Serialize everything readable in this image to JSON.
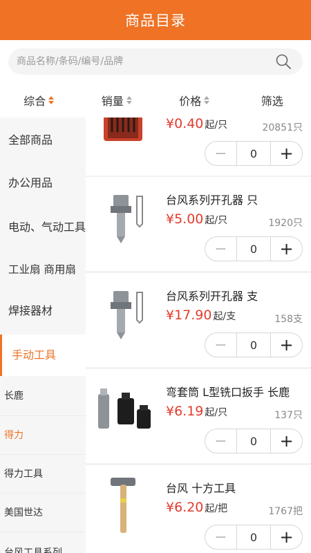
{
  "header": {
    "title": "商品目录"
  },
  "search": {
    "placeholder": "商品名称/条码/编号/品牌",
    "icon": "search-icon"
  },
  "sort": {
    "items": [
      {
        "label": "综合",
        "arrows": true,
        "active": true
      },
      {
        "label": "销量",
        "arrows": true,
        "active": false
      },
      {
        "label": "价格",
        "arrows": true,
        "active": false
      },
      {
        "label": "筛选",
        "arrows": false,
        "active": false
      }
    ]
  },
  "sidebar": {
    "categories": [
      "全部商品",
      "办公用品",
      "电动、气动工具",
      "工业扇 商用扇",
      "焊接器材",
      "手动工具"
    ],
    "subcategories": [
      "长鹿",
      "得力",
      "得力工具",
      "美国世达",
      "台风工具系列"
    ]
  },
  "products": [
    {
      "name": "",
      "price": "¥0.40",
      "unit": "起/只",
      "stock": "20851只",
      "qty": "0",
      "image": "screwdriver-set"
    },
    {
      "name": "台风系列开孔器 只",
      "price": "¥5.00",
      "unit": "起/只",
      "stock": "1920只",
      "qty": "0",
      "image": "hole-saw"
    },
    {
      "name": "台风系列开孔器  支",
      "price": "¥17.90",
      "unit": "起/支",
      "stock": "158支",
      "qty": "0",
      "image": "hole-saw"
    },
    {
      "name": "弯套筒 L型铣口扳手 长鹿",
      "price": "¥6.19",
      "unit": "起/只",
      "stock": "137只",
      "qty": "0",
      "image": "socket-adapters"
    },
    {
      "name": "台风 十方工具",
      "price": "¥6.20",
      "unit": "起/把",
      "stock": "1767把",
      "qty": "0",
      "image": "hammer"
    }
  ],
  "stepper": {
    "minus": "−",
    "plus": "+"
  }
}
